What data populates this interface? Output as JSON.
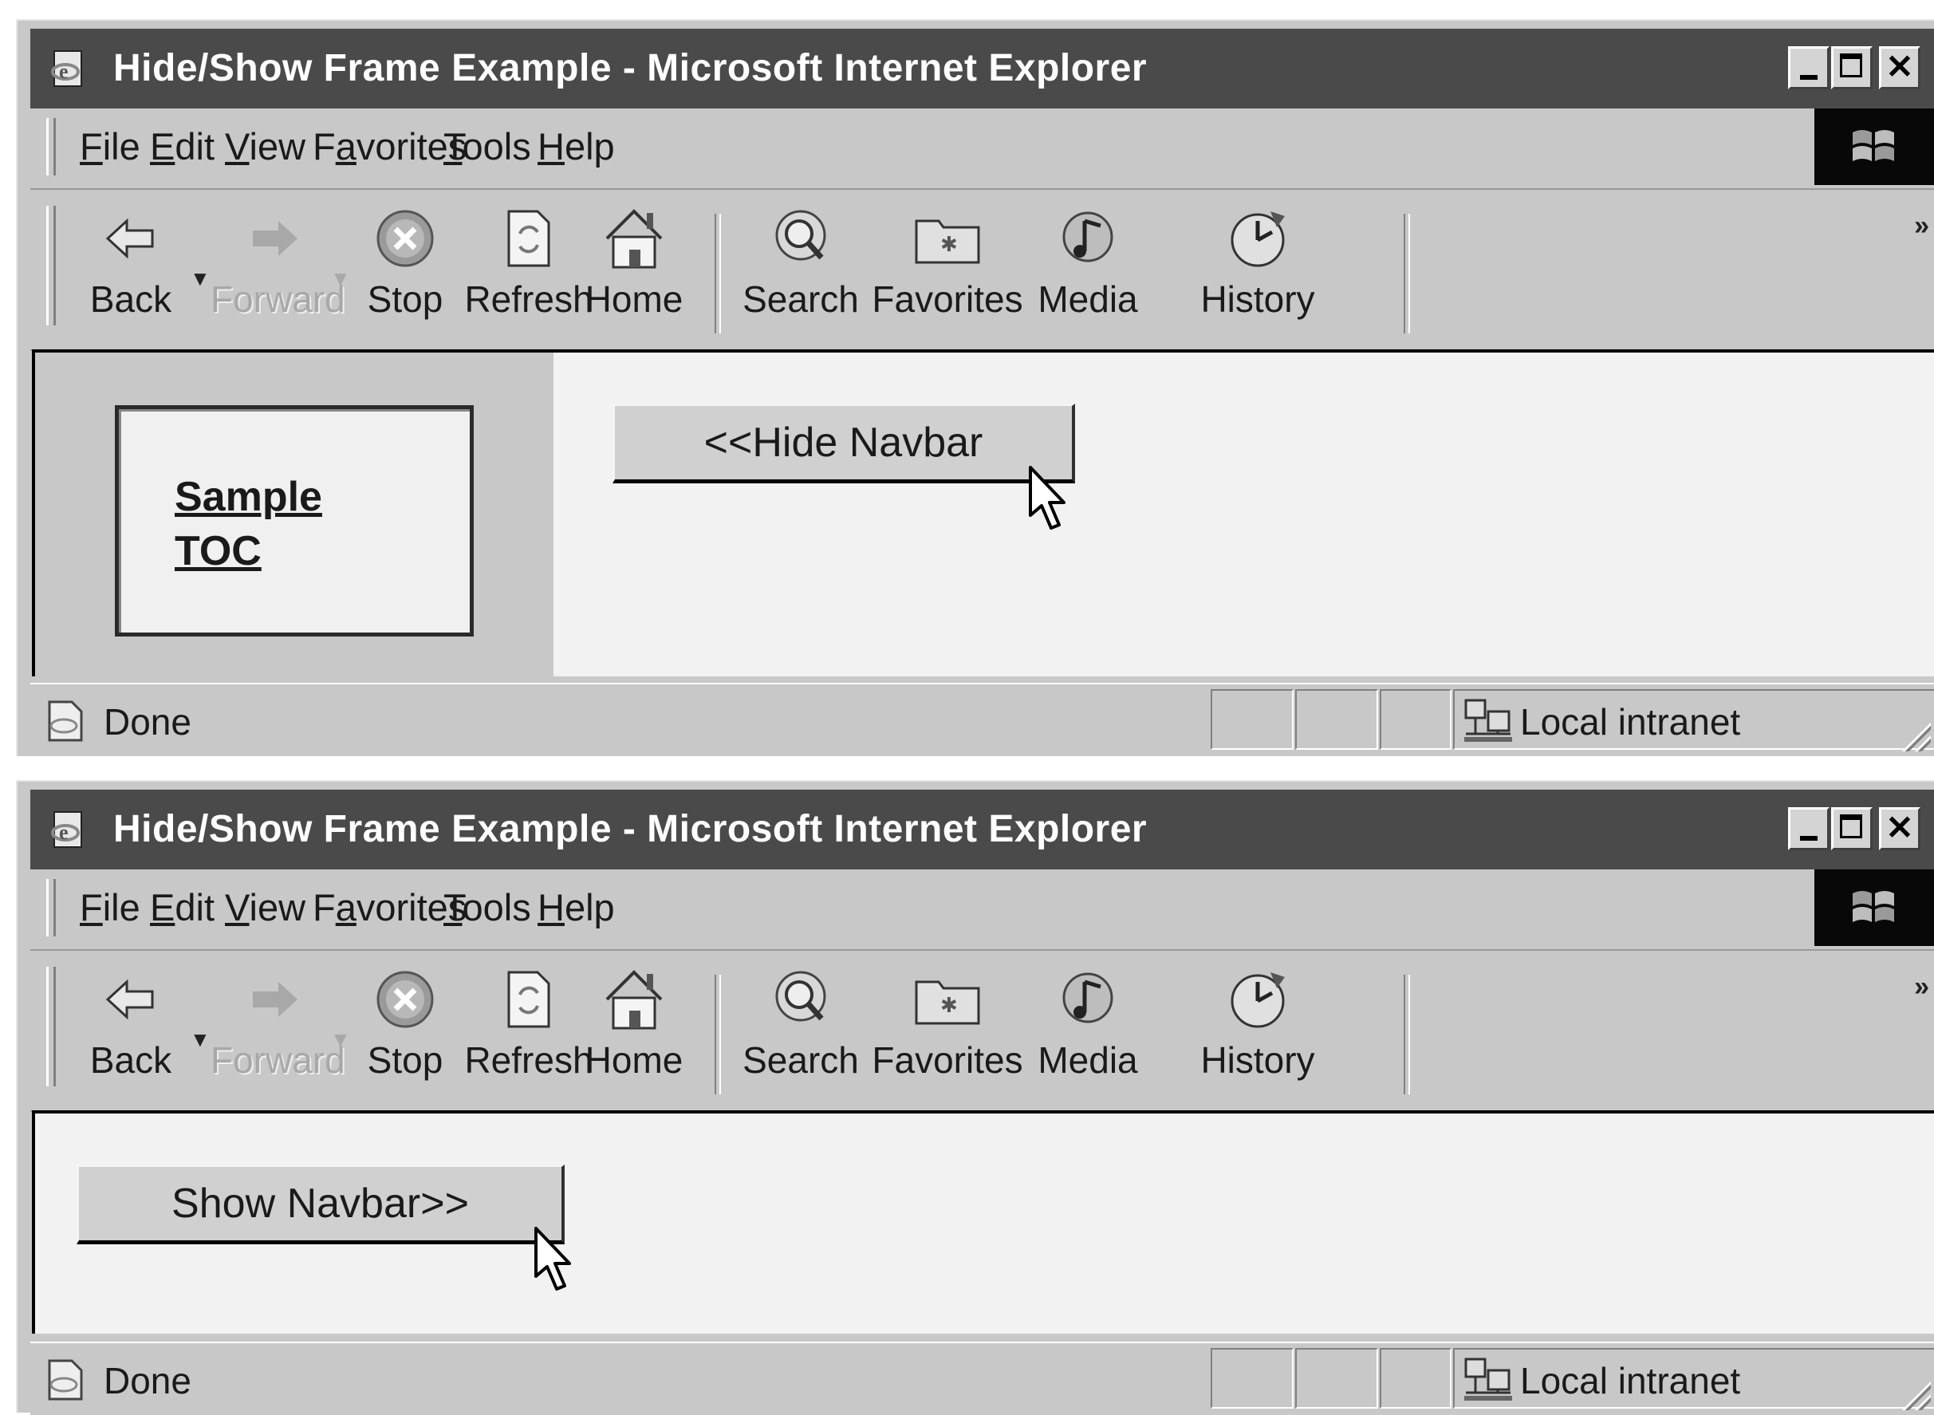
{
  "windows": [
    {
      "title": "Hide/Show Frame Example - Microsoft Internet Explorer",
      "menu": [
        "File",
        "Edit",
        "View",
        "Favorites",
        "Tools",
        "Help"
      ],
      "menu_mnemonics": [
        "F",
        "E",
        "V",
        "a",
        "T",
        "H"
      ],
      "toolbar": {
        "back": "Back",
        "forward": "Forward",
        "stop": "Stop",
        "refresh": "Refresh",
        "home": "Home",
        "search": "Search",
        "favorites": "Favorites",
        "media": "Media",
        "history": "History",
        "more": "»"
      },
      "nav_link": "Sample TOC",
      "page_button": "<<Hide Navbar",
      "status": "Done",
      "zone": "Local intranet"
    },
    {
      "title": "Hide/Show Frame Example - Microsoft Internet Explorer",
      "menu": [
        "File",
        "Edit",
        "View",
        "Favorites",
        "Tools",
        "Help"
      ],
      "menu_mnemonics": [
        "F",
        "E",
        "V",
        "a",
        "T",
        "H"
      ],
      "toolbar": {
        "back": "Back",
        "forward": "Forward",
        "stop": "Stop",
        "refresh": "Refresh",
        "home": "Home",
        "search": "Search",
        "favorites": "Favorites",
        "media": "Media",
        "history": "History",
        "more": "»"
      },
      "page_button": "Show Navbar>>",
      "status": "Done",
      "zone": "Local intranet"
    }
  ],
  "colors": {
    "titlebar": "#4a4a4a",
    "chrome": "#c8c8c8",
    "content": "#f2f2f2"
  }
}
